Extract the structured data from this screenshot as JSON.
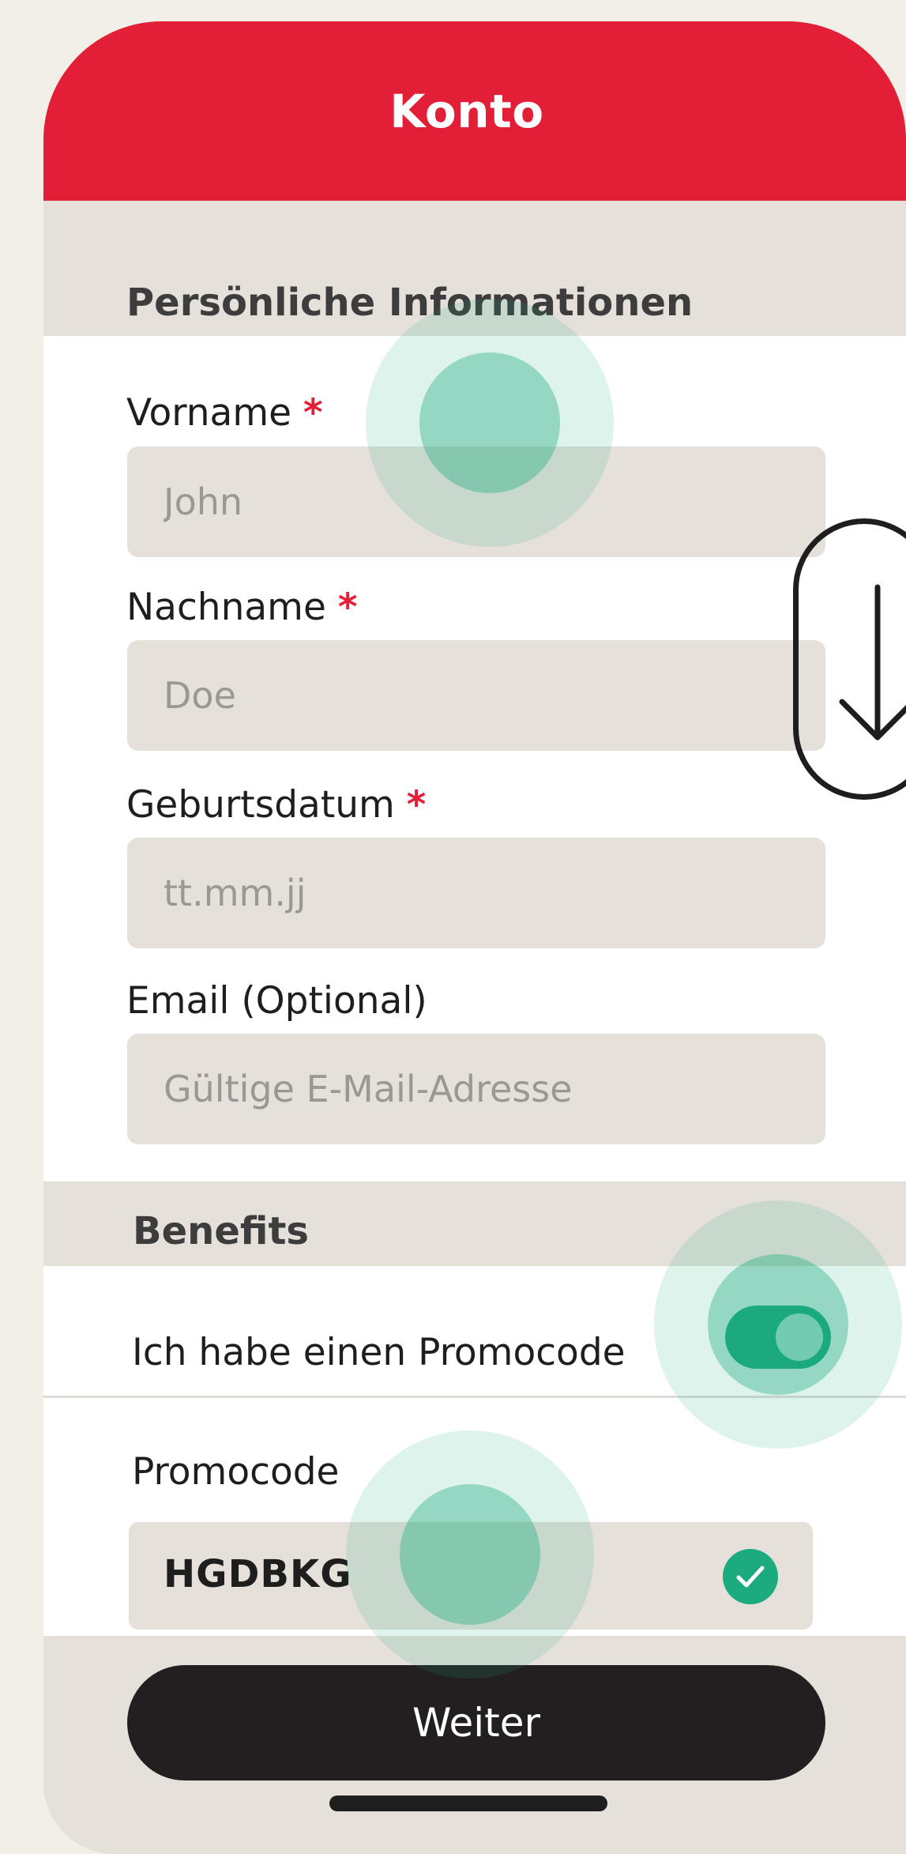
{
  "header": {
    "title": "Konto"
  },
  "personal_info": {
    "section_title": "Persönliche Informationen",
    "fields": [
      {
        "label": "Vorname",
        "required_mark": "*",
        "placeholder": "John"
      },
      {
        "label": "Nachname",
        "required_mark": "*",
        "placeholder": "Doe"
      },
      {
        "label": "Geburtsdatum",
        "required_mark": "*",
        "placeholder": "tt.mm.jj"
      },
      {
        "label": "Email (Optional)",
        "placeholder": "Gültige E-Mail-Adresse"
      }
    ]
  },
  "benefits": {
    "section_title": "Benefits",
    "promo_toggle": {
      "label": "Ich habe einen Promocode",
      "state": "on"
    },
    "promo_field": {
      "label": "Promocode",
      "value": "HGDBKG",
      "status_icon": "check-circle-icon"
    }
  },
  "actions": {
    "continue_label": "Weiter"
  },
  "overlays": {
    "scroll_hint_icon": "arrow-down-icon"
  },
  "colors": {
    "brand_red": "#e31f37",
    "accent_green": "#1bab7f",
    "button_dark": "#231f20",
    "field_bg": "#e5e0da"
  }
}
